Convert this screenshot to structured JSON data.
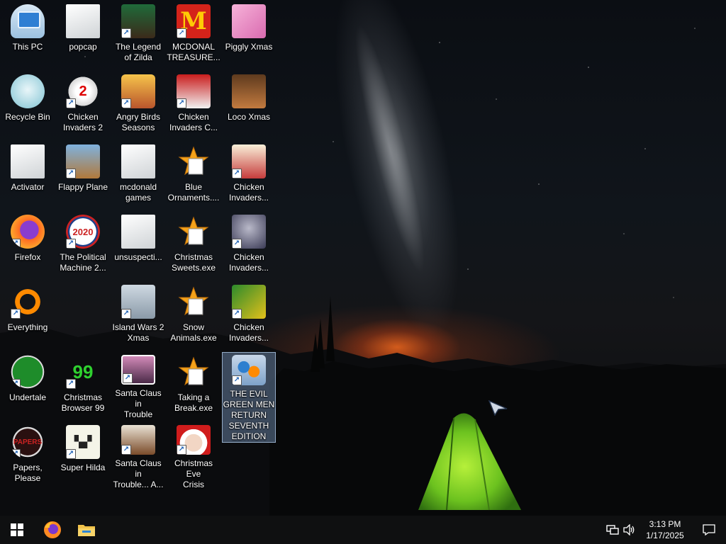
{
  "desktop": {
    "icons": [
      {
        "label": "This PC",
        "icon": "this-pc-icon",
        "shortcut": false
      },
      {
        "label": "popcap",
        "icon": "folder-icon",
        "shortcut": false
      },
      {
        "label": "The Legend\nof Zilda",
        "icon": "zilda-game-icon",
        "shortcut": true
      },
      {
        "label": "MCDONAL\nTREASURE...",
        "icon": "mcdonalds-icon",
        "shortcut": true
      },
      {
        "label": "Piggly Xmas",
        "icon": "piggy-icon",
        "shortcut": false
      },
      {
        "label": "Recycle Bin",
        "icon": "recycle-bin-icon",
        "shortcut": false
      },
      {
        "label": "Chicken\nInvaders 2",
        "icon": "chicken-invaders-2-icon",
        "shortcut": true
      },
      {
        "label": "Angry Birds\nSeasons",
        "icon": "angry-birds-icon",
        "shortcut": true
      },
      {
        "label": "Chicken\nInvaders C...",
        "icon": "chicken-invaders-christmas-icon",
        "shortcut": true
      },
      {
        "label": "Loco Xmas",
        "icon": "teddy-bear-icon",
        "shortcut": false
      },
      {
        "label": "Activator",
        "icon": "folder-icon",
        "shortcut": false
      },
      {
        "label": "Flappy Plane",
        "icon": "flappy-plane-icon",
        "shortcut": true
      },
      {
        "label": "mcdonald\ngames",
        "icon": "folder-icon",
        "shortcut": false
      },
      {
        "label": "Blue\nOrnaments....",
        "icon": "star-exe-icon",
        "shortcut": false
      },
      {
        "label": "Chicken\nInvaders...",
        "icon": "chicken-invaders-icon",
        "shortcut": true
      },
      {
        "label": "Firefox",
        "icon": "firefox-icon",
        "shortcut": true
      },
      {
        "label": "The Political\nMachine 2...",
        "icon": "political-machine-icon",
        "shortcut": true
      },
      {
        "label": "unsuspecti...",
        "icon": "folder-icon",
        "shortcut": false
      },
      {
        "label": "Christmas\nSweets.exe",
        "icon": "star-exe-icon",
        "shortcut": false
      },
      {
        "label": "Chicken\nInvaders...",
        "icon": "chicken-invaders-space-icon",
        "shortcut": true
      },
      {
        "label": "Everything",
        "icon": "everything-search-icon",
        "shortcut": true
      },
      {
        "label": "Island Wars 2\nXmas",
        "icon": "island-wars-icon",
        "shortcut": true
      },
      {
        "label": "Snow\nAnimals.exe",
        "icon": "star-exe-icon",
        "shortcut": false
      },
      {
        "label": "Chicken\nInvaders...",
        "icon": "chicken-invaders-green-icon",
        "shortcut": true
      },
      {
        "label": "Undertale",
        "icon": "undertale-icon",
        "shortcut": true
      },
      {
        "label": "Christmas\nBrowser 99",
        "icon": "christmas-tree-icon",
        "shortcut": true
      },
      {
        "label": "Santa Claus in\nTrouble",
        "icon": "santa-claus-icon",
        "shortcut": true
      },
      {
        "label": "Taking a\nBreak.exe",
        "icon": "star-exe-icon",
        "shortcut": false
      },
      {
        "label": "THE EVIL\nGREEN MEN\nRETURN\nSEVENTH\nEDITION",
        "icon": "evil-green-men-icon",
        "shortcut": true,
        "selected": true
      },
      {
        "label": "Papers, Please",
        "icon": "papers-please-icon",
        "shortcut": true
      },
      {
        "label": "Super Hilda",
        "icon": "super-hilda-icon",
        "shortcut": true
      },
      {
        "label": "Santa Claus in\nTrouble... A...",
        "icon": "santa-claus-2-icon",
        "shortcut": true
      },
      {
        "label": "Christmas Eve\nCrisis",
        "icon": "santa-face-icon",
        "shortcut": true
      }
    ]
  },
  "taskbar": {
    "start": "windows-start-icon",
    "pinned": [
      "firefox-icon",
      "file-explorer-icon"
    ],
    "tray": {
      "network": "network-icon",
      "volume": "volume-icon",
      "time": "3:13 PM",
      "date": "1/17/2025",
      "notifications": "notification-center-icon"
    }
  },
  "colors": {
    "taskbar": "#0f1011",
    "selection": "#7896be",
    "tent": "#7ccf2a",
    "horizon_glow": "#ff6e1e"
  }
}
